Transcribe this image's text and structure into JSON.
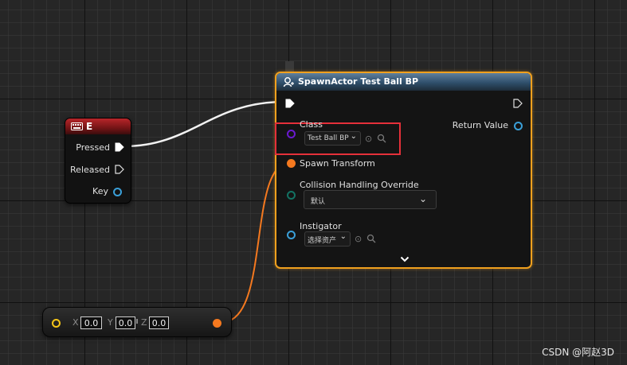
{
  "key_event": {
    "title": "E",
    "pins": {
      "pressed": "Pressed",
      "released": "Released",
      "key": "Key"
    }
  },
  "spawn_actor": {
    "title": "SpawnActor Test Ball BP",
    "pins": {
      "class": "Class",
      "class_value": "Test Ball BP",
      "return_value": "Return Value",
      "spawn_transform": "Spawn Transform",
      "collision_handling": "Collision Handling Override",
      "collision_value": "默认",
      "instigator": "Instigator",
      "instigator_value": "选择资产"
    }
  },
  "make_transform": {
    "x_label": "X",
    "x_value": "0.0",
    "y_label": "Y",
    "y_value": "0.0",
    "z_label": "Z",
    "z_value": "0.0"
  },
  "watermark": "CSDN @阿赵3D",
  "colors": {
    "exec_wire": "#ffffff",
    "transform_pin": "#f5791f",
    "class_pin": "#6a1ad0",
    "struct_pin": "#3a9fd8",
    "byte_pin": "#137263",
    "vector_pin": "#f5c518",
    "node_selected_border": "#f0a01e",
    "highlight_box": "#e5303a"
  },
  "icons": {
    "keyboard": "keyboard-icon",
    "spawn": "spawn-actor-icon",
    "browse": "browse-arrow-icon",
    "search": "search-icon",
    "dropdown": "chevron-down-icon",
    "advanced": "expand-chevron-icon"
  }
}
